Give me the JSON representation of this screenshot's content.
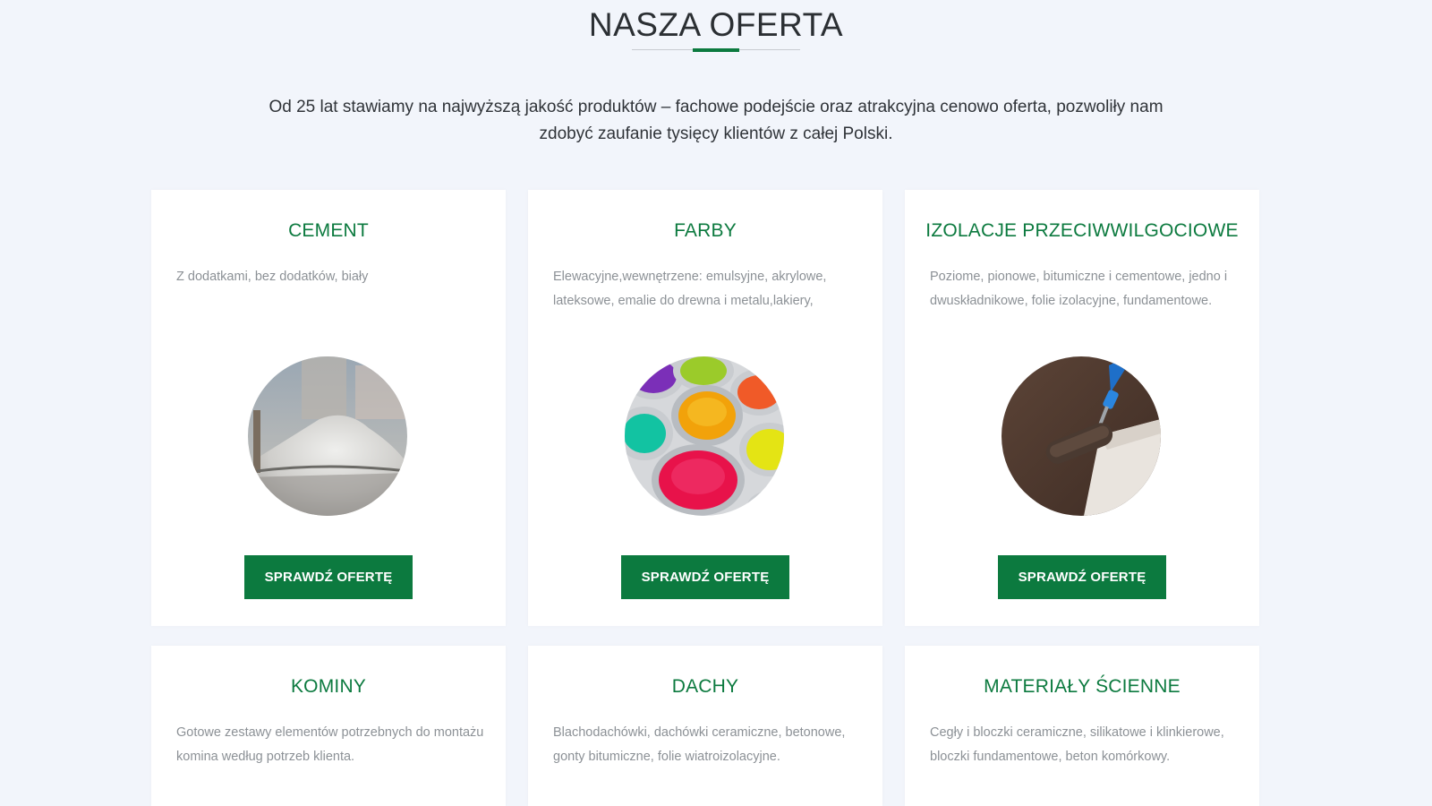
{
  "section": {
    "title": "NASZA OFERTA",
    "intro": "Od 25 lat stawiamy na najwyższą jakość produktów – fachowe podejście oraz atrakcyjna cenowo oferta, pozwoliły nam zdobyć zaufanie tysięcy klientów z całej Polski."
  },
  "colors": {
    "accent": "#0c7a3f",
    "page_background": "#f2f5fb",
    "card_background": "#ffffff",
    "description_text": "#8c9196"
  },
  "cards": [
    {
      "title": "CEMENT",
      "description": "Z dodatkami, bez dodatków, biały",
      "image": "cement-powder-image",
      "button": "SPRAWDŹ OFERTĘ"
    },
    {
      "title": "FARBY",
      "description": "Elewacyjne,wewnętrzene: emulsyjne, akrylowe, lateksowe, emalie do drewna i metalu,lakiery,",
      "image": "paint-cans-image",
      "button": "SPRAWDŹ OFERTĘ"
    },
    {
      "title": "IZOLACJE PRZECIWWILGOCIOWE",
      "description": "Poziome, pionowe, bitumiczne i cementowe, jedno i dwuskładnikowe, folie izolacyjne, fundamentowe.",
      "image": "roller-waterproofing-image",
      "button": "SPRAWDŹ OFERTĘ"
    },
    {
      "title": "KOMINY",
      "description": "Gotowe zestawy elementów potrzebnych do montażu komina według potrzeb klienta."
    },
    {
      "title": "DACHY",
      "description": "Blachodachówki, dachówki ceramiczne, betonowe, gonty bitumiczne, folie wiatroizolacyjne."
    },
    {
      "title": "MATERIAŁY ŚCIENNE",
      "description": "Cegły i bloczki ceramiczne, silikatowe i klinkierowe, bloczki fundamentowe, beton komórkowy."
    }
  ]
}
